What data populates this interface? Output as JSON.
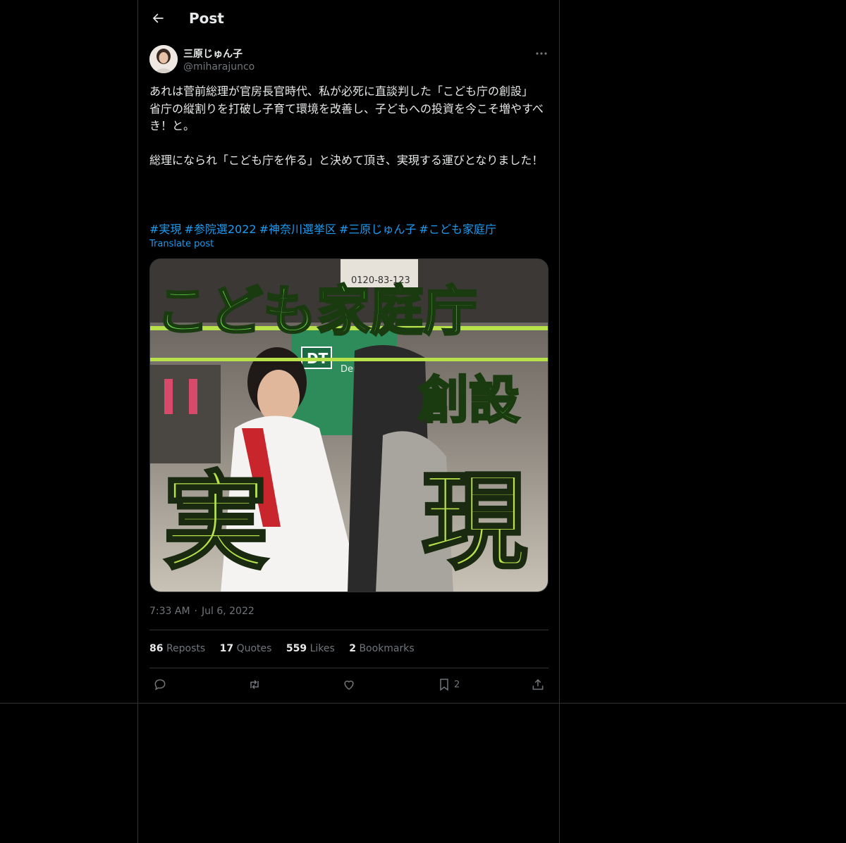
{
  "header": {
    "title": "Post"
  },
  "author": {
    "name": "三原じゅん子",
    "handle": "@miharajunco"
  },
  "post": {
    "text": "あれは菅前総理が官房長官時代、私が必死に直談判した「こども庁の創設」\n省庁の縦割りを打破し子育て環境を改善し、子どもへの投資を今こそ増やすべき！と。\n\n総理になられ「こども庁を作る」と決めて頂き、実現する運びとなりました！",
    "hashtags": [
      "#実現",
      "#参院選2022",
      "#神奈川選挙区",
      "#三原じゅん子",
      "#こども家庭庁"
    ],
    "translate_label": "Translate post",
    "time": "7:33 AM",
    "date": "Jul 6, 2022"
  },
  "media": {
    "headline": "こども家庭庁",
    "subline": "創設",
    "word_left": "実",
    "word_right": "現",
    "sign_text": "DT",
    "sign_sub": "Den-en",
    "sign_num": "0120-83-123"
  },
  "stats": {
    "reposts": {
      "count": "86",
      "label": "Reposts"
    },
    "quotes": {
      "count": "17",
      "label": "Quotes"
    },
    "likes": {
      "count": "559",
      "label": "Likes"
    },
    "bookmarks": {
      "count": "2",
      "label": "Bookmarks"
    }
  },
  "actions": {
    "bookmark_count": "2"
  },
  "colors": {
    "accent": "#1d9bf0",
    "muted": "#71767b",
    "text": "#e7e9ea",
    "border": "#2f3336",
    "highlight": "#5fd14a"
  }
}
